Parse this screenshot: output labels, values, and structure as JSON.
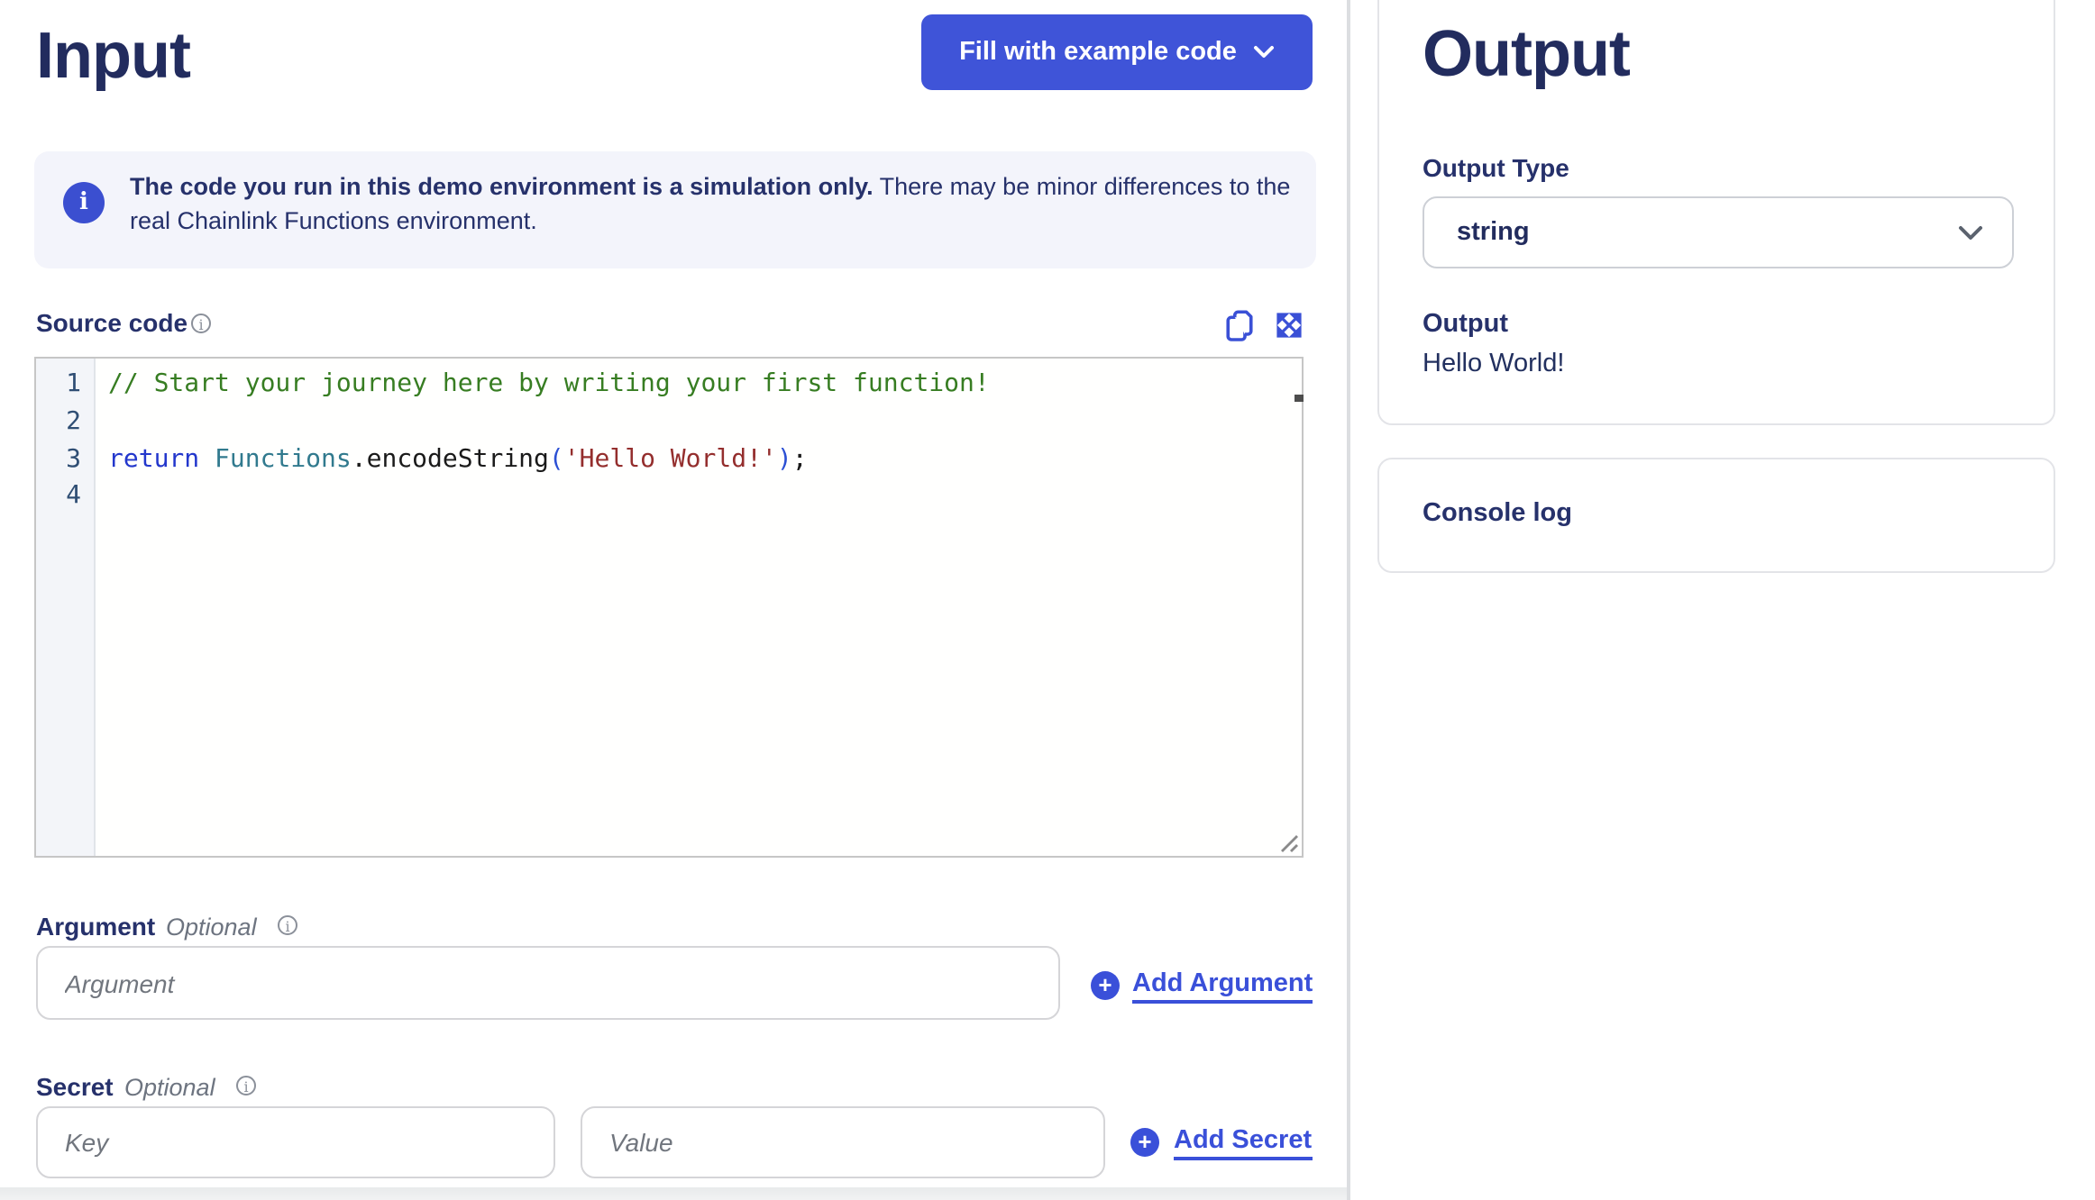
{
  "input_panel": {
    "title": "Input",
    "fill_button_label": "Fill with example code",
    "banner": {
      "bold_text": "The code you run in this demo environment is a simulation only.",
      "regular_text": " There may be minor differences to the real Chainlink Functions environment."
    },
    "source_code": {
      "label": "Source code",
      "lines": [
        {
          "num": "1",
          "tokens": [
            {
              "c": "co",
              "t": "// Start your journey here by writing your first function!"
            }
          ]
        },
        {
          "num": "2",
          "tokens": []
        },
        {
          "num": "3",
          "tokens": [
            {
              "c": "kw",
              "t": "return"
            },
            {
              "c": "pl",
              "t": " "
            },
            {
              "c": "ty",
              "t": "Functions"
            },
            {
              "c": "pl",
              "t": ".encodeString"
            },
            {
              "c": "pa",
              "t": "("
            },
            {
              "c": "st",
              "t": "'Hello World!'"
            },
            {
              "c": "pa",
              "t": ")"
            },
            {
              "c": "pl",
              "t": ";"
            }
          ]
        },
        {
          "num": "4",
          "tokens": []
        }
      ]
    },
    "argument": {
      "label": "Argument",
      "optional_label": "Optional",
      "placeholder": "Argument",
      "value": "",
      "add_label": "Add Argument"
    },
    "secret": {
      "label": "Secret",
      "optional_label": "Optional",
      "key_placeholder": "Key",
      "key_value": "",
      "value_placeholder": "Value",
      "value_value": "",
      "add_label": "Add Secret"
    }
  },
  "output_panel": {
    "title": "Output",
    "output_type_label": "Output Type",
    "output_type_value": "string",
    "output_label": "Output",
    "output_value": "Hello World!",
    "console_log_label": "Console log"
  },
  "icons": {
    "button_chevron": "chevron-down-icon",
    "banner_info": "info-icon",
    "copy": "copy-icon",
    "expand": "expand-icon",
    "add": "plus-circle-icon",
    "select_chevron": "chevron-down-icon"
  },
  "colors": {
    "accent_blue": "#3f54d8",
    "link_blue": "#3a50d9",
    "navy_text": "#26316b",
    "heading_navy": "#222c5e",
    "banner_bg": "#f3f4fb",
    "code_comment": "#377d22",
    "code_keyword": "#2337cc",
    "code_type": "#317a8e",
    "code_string": "#942e2d",
    "code_paren": "#2c50d4"
  }
}
